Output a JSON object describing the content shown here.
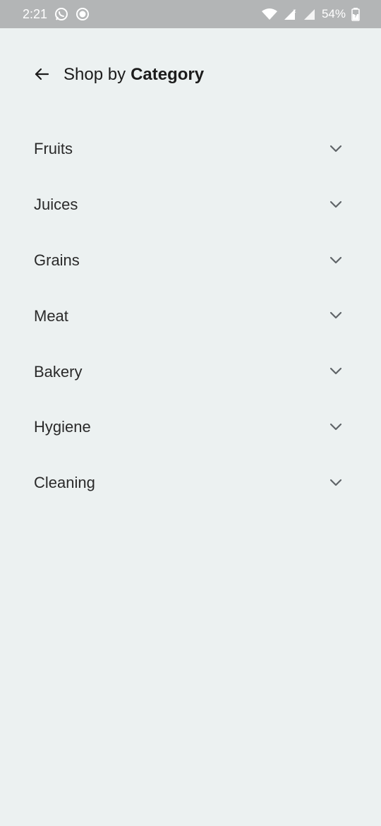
{
  "status_bar": {
    "time": "2:21",
    "battery": "54%",
    "icons": [
      "whatsapp-icon",
      "record-icon",
      "wifi-icon",
      "signal-icon",
      "signal-icon",
      "battery-charging-icon"
    ]
  },
  "header": {
    "title_prefix": "Shop by",
    "title_bold": "Category",
    "back_icon": "arrow-back-icon"
  },
  "categories": [
    {
      "label": "Fruits"
    },
    {
      "label": "Juices"
    },
    {
      "label": "Grains"
    },
    {
      "label": "Meat"
    },
    {
      "label": "Bakery"
    },
    {
      "label": "Hygiene"
    },
    {
      "label": "Cleaning"
    }
  ],
  "colors": {
    "background": "#ecf1f1",
    "status_bar": "#b3b5b6",
    "text": "#2a2a2a",
    "chevron": "#5f6468"
  }
}
